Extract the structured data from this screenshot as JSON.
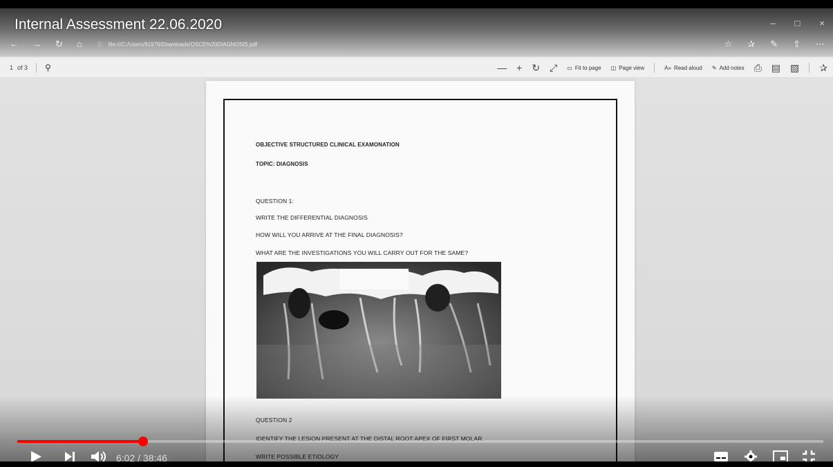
{
  "video": {
    "title": "Internal Assessment 22.06.2020",
    "time_current": "6:02",
    "time_separator": " / ",
    "time_total": "38:46",
    "progress": 0.156,
    "accent_color": "#ff0000"
  },
  "browser": {
    "address": "file:///C:/Users/91979/Downloads/OSCE%20DIAGNOSIS.pdf",
    "window_controls": [
      "–",
      "□",
      "×"
    ]
  },
  "pdf_toolbar": {
    "page_number": "1",
    "page_count": "of 3",
    "fit_to_page": "Fit to page",
    "page_view": "Page view",
    "read_aloud": "Read aloud",
    "add_notes": "Add notes"
  },
  "document": {
    "heading": "OBJECTIVE STRUCTURED CLINICAL EXAMONATION",
    "topic": "TOPIC: DIAGNOSIS",
    "q1_label": "QUESTION 1:",
    "q1_line1": "WRITE THE DIFFERENTIAL DIAGNOSIS",
    "q1_line2": "HOW WILL YOU ARRIVE AT THE FINAL DIAGNOSIS?",
    "q1_line3": "WHAT ARE THE INVESTIGATIONS YOU WILL CARRY OUT FOR THE SAME?",
    "q2_label": "QUESTION 2",
    "q2_line1": "IDENTIFY THE LESION PRESENT AT THE DISTAL ROOT APEX OF FIRST MOLAR.",
    "q2_line2": "WRITE POSSIBLE ETIOLOGY"
  }
}
